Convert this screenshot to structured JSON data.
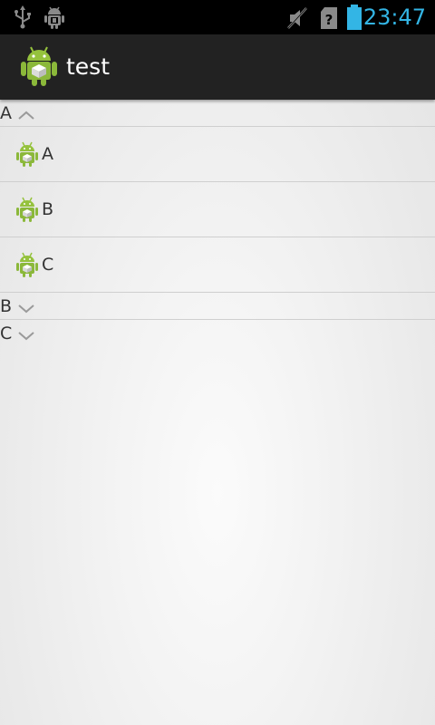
{
  "status_bar": {
    "time": "23:47",
    "time_color": "#33b5e5",
    "icons": [
      "usb-icon",
      "android-debug-icon",
      "mute-icon",
      "sim-unknown-icon",
      "battery-icon"
    ]
  },
  "action_bar": {
    "app_icon": "android-launcher-icon",
    "title": "test"
  },
  "list": {
    "groups": [
      {
        "label": "A",
        "expanded": true,
        "indicator": "chevron-up-icon",
        "children": [
          {
            "label": "A",
            "icon": "android-icon"
          },
          {
            "label": "B",
            "icon": "android-icon"
          },
          {
            "label": "C",
            "icon": "android-icon"
          }
        ]
      },
      {
        "label": "B",
        "expanded": false,
        "indicator": "chevron-down-icon",
        "children": []
      },
      {
        "label": "C",
        "expanded": false,
        "indicator": "chevron-down-icon",
        "children": []
      }
    ]
  }
}
